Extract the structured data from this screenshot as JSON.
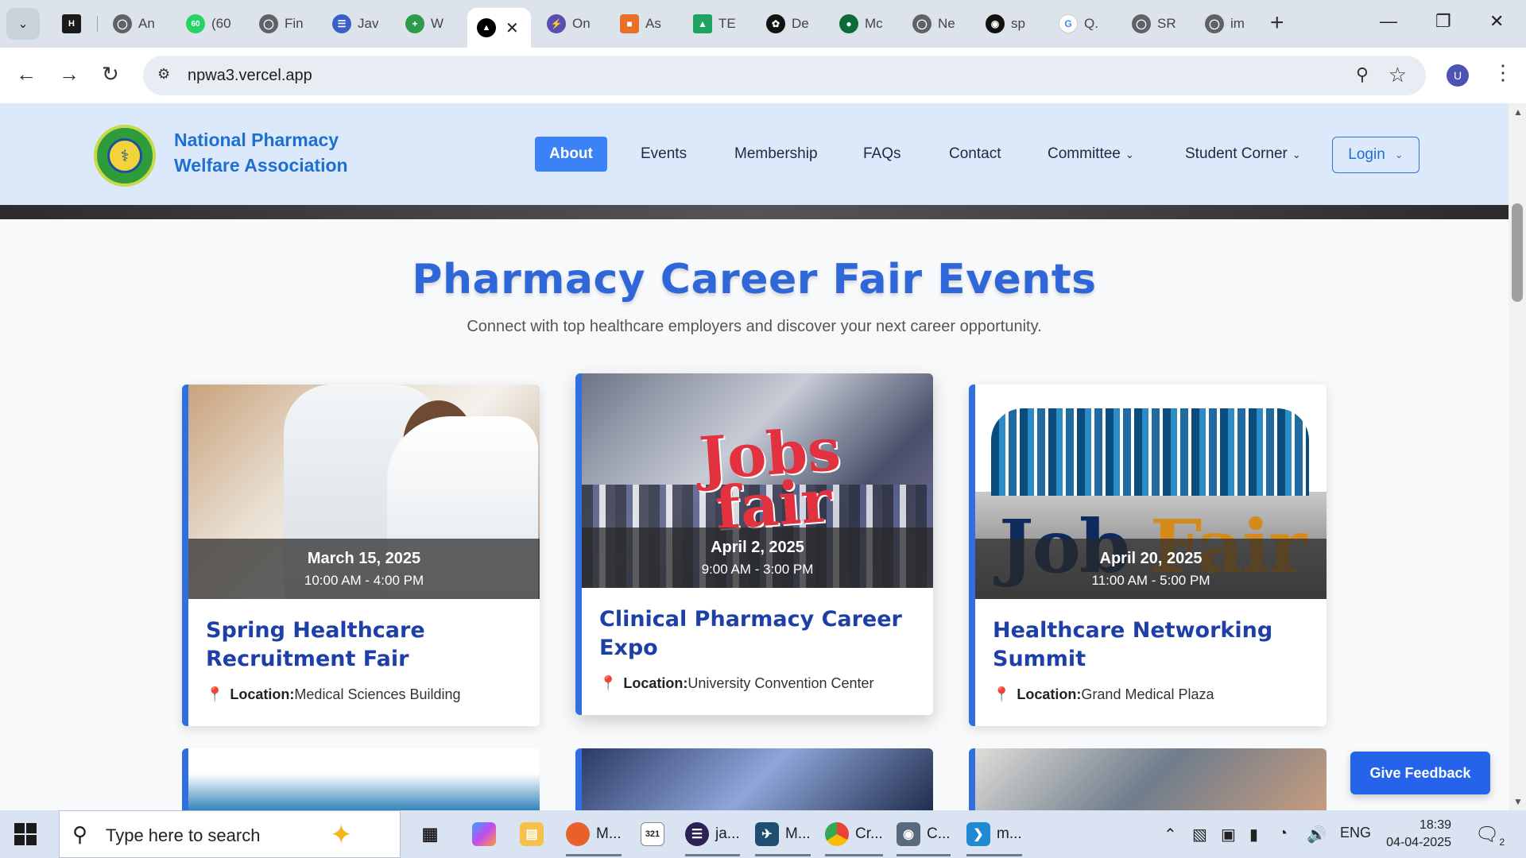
{
  "browser": {
    "tabs": [
      {
        "title": "",
        "favicon": "hackerrank-icon",
        "color": "#1b1b1b"
      },
      {
        "title": "An",
        "favicon": "globe-icon",
        "color": "#5f6368"
      },
      {
        "title": "(60",
        "favicon": "whatsapp-icon",
        "color": "#25d366"
      },
      {
        "title": "Fin",
        "favicon": "globe-icon",
        "color": "#5f6368"
      },
      {
        "title": "Jav",
        "favicon": "globe-icon",
        "color": "#3a5fc8"
      },
      {
        "title": "W",
        "favicon": "plus-icon",
        "color": "#2e9b4b"
      },
      {
        "title": "",
        "favicon": "vercel-icon",
        "color": "#000000",
        "active": true
      },
      {
        "title": "On",
        "favicon": "bolt-icon",
        "color": "#5a4fb0"
      },
      {
        "title": "As",
        "favicon": "portrait-icon",
        "color": "#e8712a"
      },
      {
        "title": "TE",
        "favicon": "drive-icon",
        "color": "#1fa463"
      },
      {
        "title": "De",
        "favicon": "openai-icon",
        "color": "#111111"
      },
      {
        "title": "Mc",
        "favicon": "leaf-icon",
        "color": "#0b6b3a"
      },
      {
        "title": "Ne",
        "favicon": "globe-icon",
        "color": "#5f6368"
      },
      {
        "title": "sp",
        "favicon": "github-icon",
        "color": "#111111"
      },
      {
        "title": "Q.",
        "favicon": "google-icon",
        "color": "#4285f4"
      },
      {
        "title": "SR",
        "favicon": "globe-icon",
        "color": "#5f6368"
      },
      {
        "title": "im",
        "favicon": "globe-icon",
        "color": "#5f6368"
      }
    ],
    "url": "npwa3.vercel.app",
    "profile_initial": "U"
  },
  "site": {
    "brand_line1": "National Pharmacy",
    "brand_line2": "Welfare Association",
    "nav": [
      {
        "label": "About",
        "active": true
      },
      {
        "label": "Events"
      },
      {
        "label": "Membership"
      },
      {
        "label": "FAQs"
      },
      {
        "label": "Contact"
      },
      {
        "label": "Committee",
        "dropdown": true
      },
      {
        "label": "Student Corner",
        "dropdown": true
      }
    ],
    "login_label": "Login"
  },
  "main": {
    "title": "Pharmacy Career Fair Events",
    "subtitle": "Connect with top healthcare employers and discover your next career opportunity.",
    "location_label": "Location:",
    "events": [
      {
        "date": "March 15, 2025",
        "time": "10:00 AM - 4:00 PM",
        "title": "Spring Healthcare Recruitment Fair",
        "location": "Medical Sciences Building"
      },
      {
        "date": "April 2, 2025",
        "time": "9:00 AM - 3:00 PM",
        "title": "Clinical Pharmacy Career Expo",
        "location": "University Convention Center",
        "image_text_1": "Jobs",
        "image_text_2": "fair"
      },
      {
        "date": "April 20, 2025",
        "time": "11:00 AM - 5:00 PM",
        "title": "Healthcare Networking Summit",
        "location": "Grand Medical Plaza",
        "image_text_1": "Job",
        "image_text_2": "Fair"
      }
    ],
    "feedback_label": "Give Feedback"
  },
  "taskbar": {
    "search_placeholder": "Type here to search",
    "apps": [
      {
        "label": "",
        "icon": "task-view-icon"
      },
      {
        "label": "",
        "icon": "copilot-icon"
      },
      {
        "label": "",
        "icon": "file-explorer-icon"
      },
      {
        "label": "M...",
        "icon": "firefox-icon"
      },
      {
        "label": "",
        "icon": "calendar-icon"
      },
      {
        "label": "ja...",
        "icon": "eclipse-icon"
      },
      {
        "label": "M...",
        "icon": "mysql-icon"
      },
      {
        "label": "Cr...",
        "icon": "chrome-icon"
      },
      {
        "label": "C...",
        "icon": "camera-icon"
      },
      {
        "label": "m...",
        "icon": "vscode-icon"
      }
    ],
    "language": "ENG",
    "time": "18:39",
    "date": "04-04-2025",
    "notification_count": "2"
  }
}
